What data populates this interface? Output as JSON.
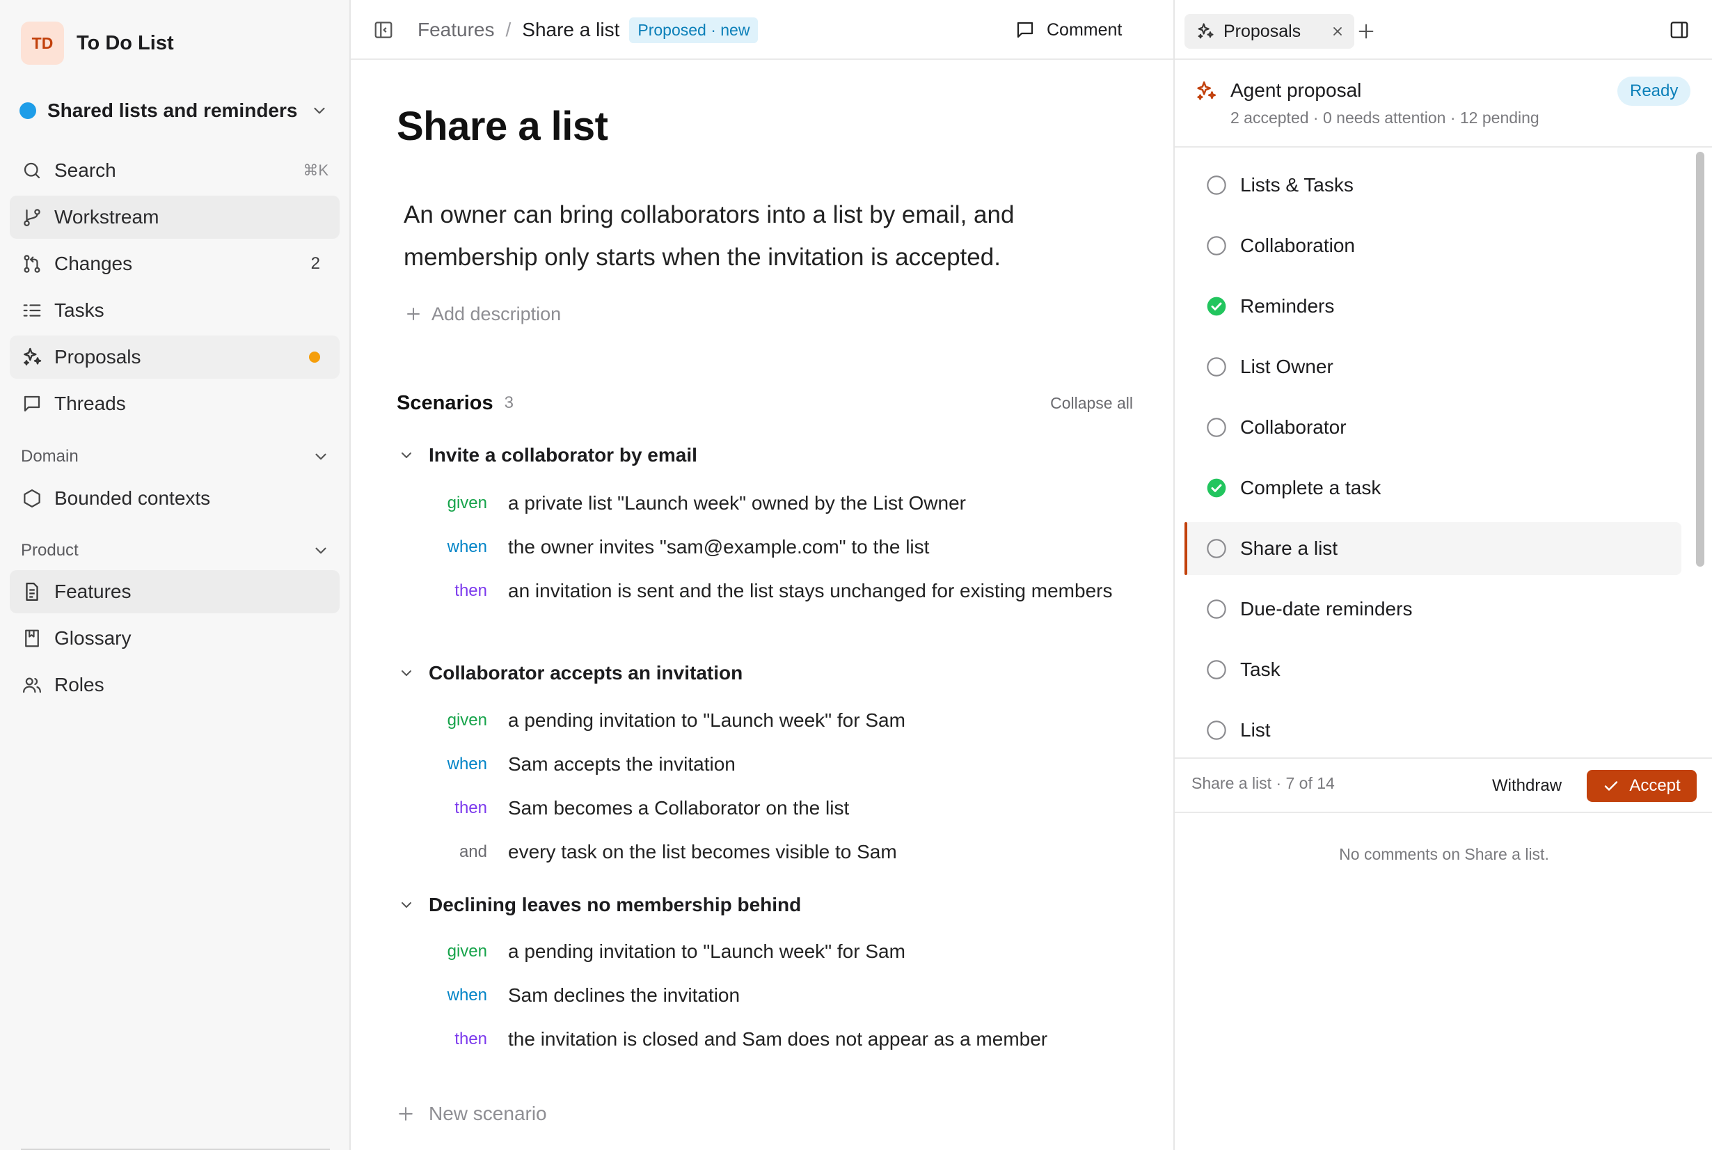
{
  "workspace": {
    "initials": "TD",
    "name": "To Do List"
  },
  "project": {
    "name": "Shared lists and reminders",
    "dot_color": "#1e9de8"
  },
  "nav": {
    "search": {
      "label": "Search",
      "shortcut": "⌘K"
    },
    "workstream": {
      "label": "Workstream"
    },
    "changes": {
      "label": "Changes",
      "count": "2"
    },
    "tasks": {
      "label": "Tasks"
    },
    "proposals": {
      "label": "Proposals",
      "dot_color": "#f59e0b"
    },
    "threads": {
      "label": "Threads"
    }
  },
  "domain_section": {
    "label": "Domain",
    "items": [
      {
        "label": "Bounded contexts"
      }
    ]
  },
  "product_section": {
    "label": "Product",
    "items": [
      {
        "label": "Features"
      },
      {
        "label": "Glossary"
      },
      {
        "label": "Roles"
      }
    ]
  },
  "breadcrumb": {
    "parent": "Features",
    "separator": "/",
    "current": "Share a list",
    "badge": "Proposed · new"
  },
  "toolbar": {
    "comment_label": "Comment"
  },
  "feature": {
    "title": "Share a list",
    "description": "An owner can bring collaborators into a list by email, and membership only starts when the invitation is accepted.",
    "add_description_label": "Add description"
  },
  "scenarios": {
    "label": "Scenarios",
    "count": "3",
    "collapse_label": "Collapse all",
    "new_label": "New scenario",
    "items": [
      {
        "title": "Invite a collaborator by email",
        "steps": [
          {
            "kw": "given",
            "text": "a private list \"Launch week\" owned by the List Owner"
          },
          {
            "kw": "when",
            "text": "the owner invites \"sam@example.com\" to the list"
          },
          {
            "kw": "then",
            "text": "an invitation is sent and the list stays unchanged for existing members"
          }
        ]
      },
      {
        "title": "Collaborator accepts an invitation",
        "steps": [
          {
            "kw": "given",
            "text": "a pending invitation to \"Launch week\" for Sam"
          },
          {
            "kw": "when",
            "text": "Sam accepts the invitation"
          },
          {
            "kw": "then",
            "text": "Sam becomes a Collaborator on the list"
          },
          {
            "kw": "and",
            "text": "every task on the list becomes visible to Sam"
          }
        ]
      },
      {
        "title": "Declining leaves no membership behind",
        "steps": [
          {
            "kw": "given",
            "text": "a pending invitation to \"Launch week\" for Sam"
          },
          {
            "kw": "when",
            "text": "Sam declines the invitation"
          },
          {
            "kw": "then",
            "text": "the invitation is closed and Sam does not appear as a member"
          }
        ]
      }
    ]
  },
  "right_panel": {
    "tab_label": "Proposals",
    "proposal": {
      "title": "Agent proposal",
      "summary": "2 accepted · 0 needs attention · 12 pending",
      "status": "Ready"
    },
    "items": [
      {
        "label": "Lists & Tasks",
        "accepted": false
      },
      {
        "label": "Collaboration",
        "accepted": false
      },
      {
        "label": "Reminders",
        "accepted": true
      },
      {
        "label": "List Owner",
        "accepted": false
      },
      {
        "label": "Collaborator",
        "accepted": false
      },
      {
        "label": "Complete a task",
        "accepted": true
      },
      {
        "label": "Share a list",
        "accepted": false,
        "selected": true
      },
      {
        "label": "Due-date reminders",
        "accepted": false
      },
      {
        "label": "Task",
        "accepted": false
      },
      {
        "label": "List",
        "accepted": false
      }
    ],
    "footer": {
      "position": "Share a list · 7 of 14",
      "withdraw_label": "Withdraw",
      "accept_label": "Accept"
    },
    "no_comments": "No comments on Share a list."
  },
  "colors": {
    "accent": "#c2410c",
    "accepted": "#22c55e",
    "badge_bg": "#dff2fb",
    "badge_fg": "#0b7fb8",
    "kw_given": "#16a34a",
    "kw_when": "#0284c7",
    "kw_then": "#7c3aed"
  }
}
